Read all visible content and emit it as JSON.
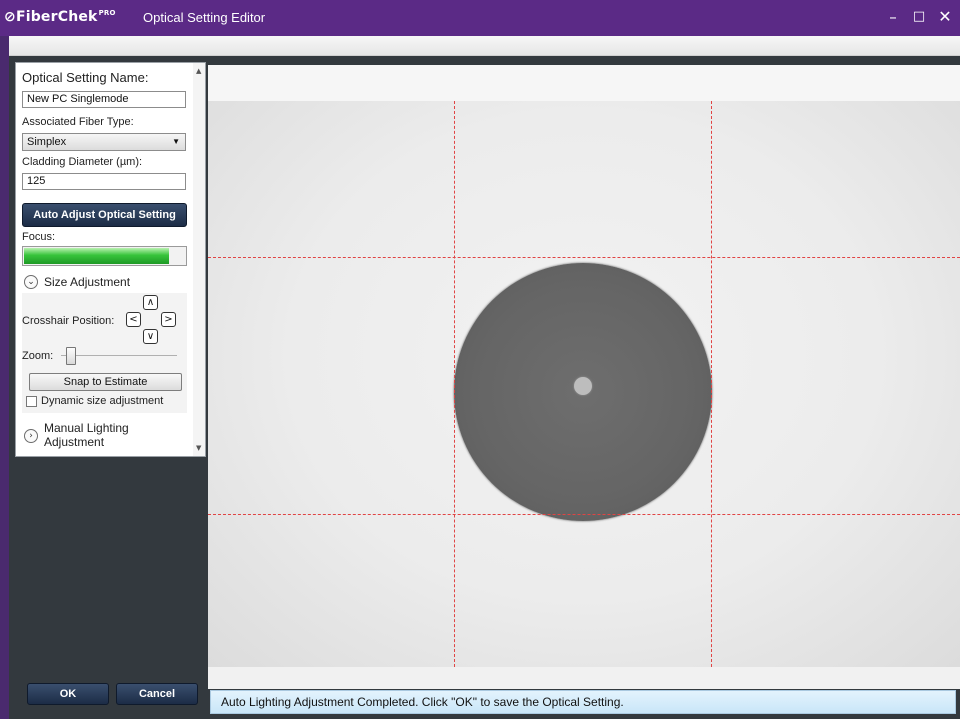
{
  "window": {
    "brand": "FiberChek",
    "brand_superscript": "PRO",
    "title": "Optical Setting Editor",
    "controls": {
      "minimize": "–",
      "maximize": "□",
      "close": "✕"
    }
  },
  "panel": {
    "setting_name_label": "Optical Setting Name:",
    "setting_name_value": "New PC Singlemode",
    "fiber_type_label": "Associated Fiber Type:",
    "fiber_type_value": "Simplex",
    "cladding_label": "Cladding Diameter (µm):",
    "cladding_value": "125",
    "auto_adjust_button": "Auto Adjust Optical Setting",
    "focus_label": "Focus:",
    "focus_level": 0.9,
    "size_adjustment_label": "Size Adjustment",
    "size_adjustment_icon": "chevron-down-circle-icon",
    "crosshair_label": "Crosshair Position:",
    "zoom_label": "Zoom:",
    "zoom_level": 0.0,
    "snap_button": "Snap to Estimate",
    "dynamic_size_label": "Dynamic size adjustment",
    "dynamic_size_checked": false,
    "manual_lighting_line1": "Manual Lighting",
    "manual_lighting_line2": "Adjustment",
    "manual_lighting_icon": "chevron-right-circle-icon"
  },
  "buttons": {
    "ok": "OK",
    "cancel": "Cancel"
  },
  "status": "Auto Lighting Adjustment Completed. Click \"OK\" to save the Optical Setting.",
  "colors": {
    "titlebar": "#5b2a86",
    "crosshair": "#e04444",
    "accent_button": "#1c2c46",
    "focus_bar": "#37c43b"
  }
}
